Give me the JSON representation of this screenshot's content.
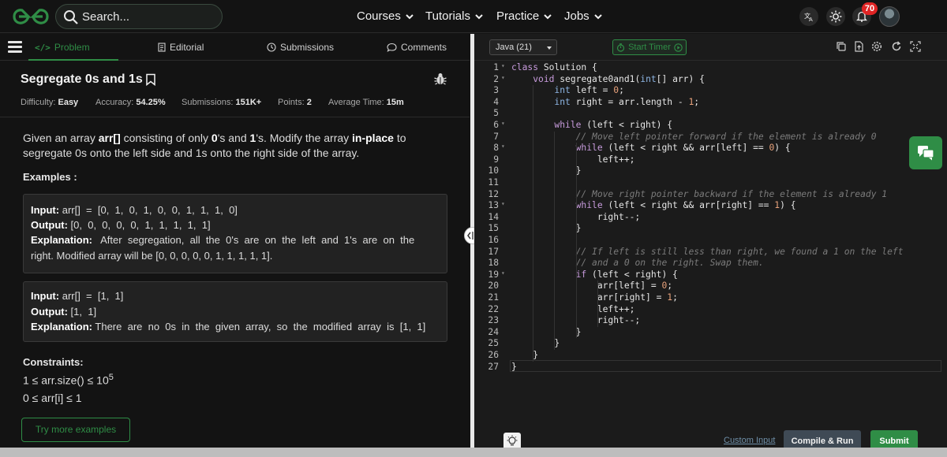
{
  "header": {
    "search_placeholder": "Search...",
    "nav": [
      "Courses",
      "Tutorials",
      "Practice",
      "Jobs"
    ],
    "notification_count": "70",
    "colors": {
      "brand": "#2f8d46",
      "badge": "#e02424"
    }
  },
  "problem_tabs": {
    "problem": "Problem",
    "editorial": "Editorial",
    "submissions": "Submissions",
    "comments": "Comments"
  },
  "problem": {
    "title": "Segregate 0s and 1s",
    "meta": {
      "difficulty_label": "Difficulty:",
      "difficulty": "Easy",
      "accuracy_label": "Accuracy:",
      "accuracy": "54.25%",
      "submissions_label": "Submissions:",
      "submissions": "151K+",
      "points_label": "Points:",
      "points": "2",
      "avg_time_label": "Average Time:",
      "avg_time": "15m"
    },
    "desc": {
      "p1": "Given an array ",
      "b1": "arr[]",
      "p2": " consisting of only ",
      "b2": "0",
      "p3": "'s and ",
      "b3": "1",
      "p4": "'s. Modify the array ",
      "b4": "in-place",
      "p5": " to segregate 0s onto the left side and 1s onto the right side of the array."
    },
    "examples_heading": "Examples :",
    "example1": {
      "input_label": "Input:",
      "input": "arr[]  =  [0,  1,  0,  1,  0,  0,  1,  1,  1,  0]",
      "output_label": "Output:",
      "output": "[0,  0,  0,  0,  0,  1,  1,  1,  1,  1]",
      "expl_label": "Explanation:",
      "expl_line1": "After  segregation,  all  the  0's  are  on  the  left  and  1's  are  on  the",
      "expl_line2": "right.  Modified  array  will  be  [0,  0,  0,  0,  0,  1,  1,  1,  1,  1]."
    },
    "example2": {
      "input_label": "Input:",
      "input": "arr[]  =  [1,  1]",
      "output_label": "Output:",
      "output": "[1,  1]",
      "expl_label": "Explanation:",
      "expl": "There  are  no  0s  in  the  given  array,  so  the  modified  array  is  [1,  1]"
    },
    "constraints_heading": "Constraints:",
    "constraint1": "1 ≤ arr.size() ≤ 10",
    "constraint1_sup": "5",
    "constraint2": "0 ≤ arr[i] ≤ 1",
    "try_button": "Try more examples"
  },
  "editor": {
    "language": "Java (21)",
    "timer_button": "Start Timer",
    "custom_input": "Custom Input",
    "compile_run": "Compile & Run",
    "submit": "Submit",
    "lines": [
      "class Solution {",
      "    void segregate0and1(int[] arr) {",
      "        int left = 0;",
      "        int right = arr.length - 1;",
      "",
      "        while (left < right) {",
      "            // Move left pointer forward if the element is already 0",
      "            while (left < right && arr[left] == 0) {",
      "                left++;",
      "            }",
      "",
      "            // Move right pointer backward if the element is already 1",
      "            while (left < right && arr[right] == 1) {",
      "                right--;",
      "            }",
      "",
      "            // If left is still less than right, we found a 1 on the left",
      "            // and a 0 on the right. Swap them.",
      "            if (left < right) {",
      "                arr[left] = 0;",
      "                arr[right] = 1;",
      "                left++;",
      "                right--;",
      "            }",
      "        }",
      "    }",
      "}"
    ]
  }
}
